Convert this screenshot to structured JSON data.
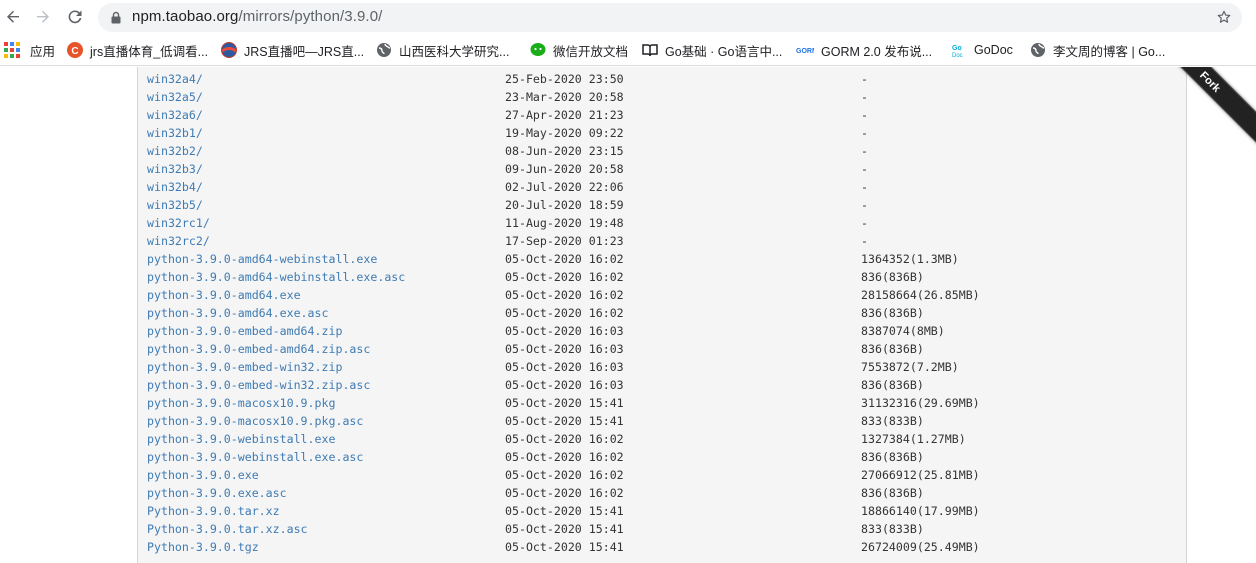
{
  "browser": {
    "url_host": "npm.taobao.org",
    "url_path": "/mirrors/python/3.9.0/"
  },
  "bookmarks": [
    {
      "label": "应用",
      "icon": "apps-grid-icon"
    },
    {
      "label": "jrs直播体育_低调看...",
      "icon": "jrs-favicon",
      "color": "#e8542a"
    },
    {
      "label": "JRS直播吧—JRS直...",
      "icon": "basketball-favicon",
      "color": "#c0392b"
    },
    {
      "label": "山西医科大学研究...",
      "icon": "globe-favicon",
      "color": "#5f6368"
    },
    {
      "label": "微信开放文档",
      "icon": "wechat-favicon",
      "color": "#1aad19"
    },
    {
      "label": "Go基础 · Go语言中...",
      "icon": "book-favicon",
      "color": "#202124"
    },
    {
      "label": "GORM 2.0 发布说...",
      "icon": "gorm-favicon",
      "color": "#1a73e8"
    },
    {
      "label": "GoDoc",
      "icon": "godoc-favicon",
      "color": "#00add8"
    },
    {
      "label": "李文周的博客 | Go...",
      "icon": "globe-favicon",
      "color": "#5f6368"
    }
  ],
  "files": [
    {
      "name": "win32a4/",
      "date": "25-Feb-2020 23:50",
      "size": "-"
    },
    {
      "name": "win32a5/",
      "date": "23-Mar-2020 20:58",
      "size": "-"
    },
    {
      "name": "win32a6/",
      "date": "27-Apr-2020 21:23",
      "size": "-"
    },
    {
      "name": "win32b1/",
      "date": "19-May-2020 09:22",
      "size": "-"
    },
    {
      "name": "win32b2/",
      "date": "08-Jun-2020 23:15",
      "size": "-"
    },
    {
      "name": "win32b3/",
      "date": "09-Jun-2020 20:58",
      "size": "-"
    },
    {
      "name": "win32b4/",
      "date": "02-Jul-2020 22:06",
      "size": "-"
    },
    {
      "name": "win32b5/",
      "date": "20-Jul-2020 18:59",
      "size": "-"
    },
    {
      "name": "win32rc1/",
      "date": "11-Aug-2020 19:48",
      "size": "-"
    },
    {
      "name": "win32rc2/",
      "date": "17-Sep-2020 01:23",
      "size": "-"
    },
    {
      "name": "python-3.9.0-amd64-webinstall.exe",
      "date": "05-Oct-2020 16:02",
      "size": "1364352(1.3MB)"
    },
    {
      "name": "python-3.9.0-amd64-webinstall.exe.asc",
      "date": "05-Oct-2020 16:02",
      "size": "836(836B)"
    },
    {
      "name": "python-3.9.0-amd64.exe",
      "date": "05-Oct-2020 16:02",
      "size": "28158664(26.85MB)"
    },
    {
      "name": "python-3.9.0-amd64.exe.asc",
      "date": "05-Oct-2020 16:02",
      "size": "836(836B)"
    },
    {
      "name": "python-3.9.0-embed-amd64.zip",
      "date": "05-Oct-2020 16:03",
      "size": "8387074(8MB)"
    },
    {
      "name": "python-3.9.0-embed-amd64.zip.asc",
      "date": "05-Oct-2020 16:03",
      "size": "836(836B)"
    },
    {
      "name": "python-3.9.0-embed-win32.zip",
      "date": "05-Oct-2020 16:03",
      "size": "7553872(7.2MB)"
    },
    {
      "name": "python-3.9.0-embed-win32.zip.asc",
      "date": "05-Oct-2020 16:03",
      "size": "836(836B)"
    },
    {
      "name": "python-3.9.0-macosx10.9.pkg",
      "date": "05-Oct-2020 15:41",
      "size": "31132316(29.69MB)"
    },
    {
      "name": "python-3.9.0-macosx10.9.pkg.asc",
      "date": "05-Oct-2020 15:41",
      "size": "833(833B)"
    },
    {
      "name": "python-3.9.0-webinstall.exe",
      "date": "05-Oct-2020 16:02",
      "size": "1327384(1.27MB)"
    },
    {
      "name": "python-3.9.0-webinstall.exe.asc",
      "date": "05-Oct-2020 16:02",
      "size": "836(836B)"
    },
    {
      "name": "python-3.9.0.exe",
      "date": "05-Oct-2020 16:02",
      "size": "27066912(25.81MB)"
    },
    {
      "name": "python-3.9.0.exe.asc",
      "date": "05-Oct-2020 16:02",
      "size": "836(836B)"
    },
    {
      "name": "Python-3.9.0.tar.xz",
      "date": "05-Oct-2020 15:41",
      "size": "18866140(17.99MB)"
    },
    {
      "name": "Python-3.9.0.tar.xz.asc",
      "date": "05-Oct-2020 15:41",
      "size": "833(833B)"
    },
    {
      "name": "Python-3.9.0.tgz",
      "date": "05-Oct-2020 15:41",
      "size": "26724009(25.49MB)"
    }
  ],
  "fork_ribbon": {
    "label": "Fork"
  },
  "colors": {
    "link": "#3f7bb3",
    "listing_bg": "#f5f5f5",
    "omnibox_bg": "#f1f3f4"
  }
}
